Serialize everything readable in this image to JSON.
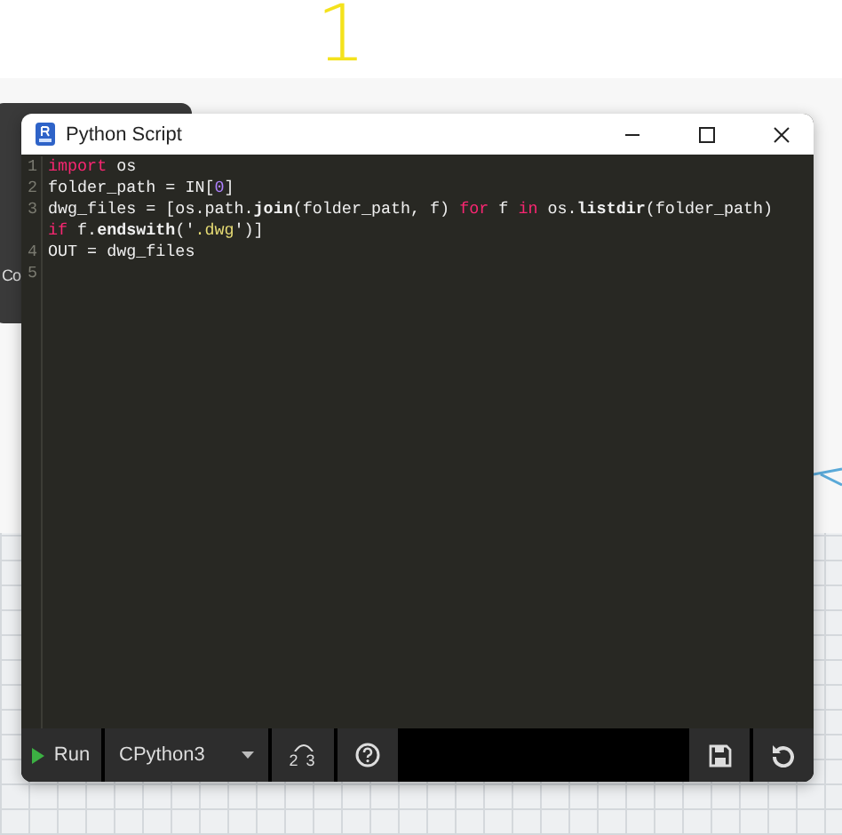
{
  "annotation": {
    "text": "1"
  },
  "background_node": {
    "text": "Co"
  },
  "window": {
    "title": "Python Script"
  },
  "editor": {
    "lines": [
      {
        "number": "1",
        "tokens": [
          {
            "text": "import",
            "kind": "keyword"
          },
          {
            "text": " os",
            "kind": "plain"
          }
        ]
      },
      {
        "number": "2",
        "tokens": [
          {
            "text": "folder_path = IN[",
            "kind": "plain"
          },
          {
            "text": "0",
            "kind": "number"
          },
          {
            "text": "]",
            "kind": "plain"
          }
        ]
      },
      {
        "number": "3",
        "tokens": [
          {
            "text": "dwg_files = [os.path.",
            "kind": "plain"
          },
          {
            "text": "join",
            "kind": "method"
          },
          {
            "text": "(folder_path, f) ",
            "kind": "plain"
          },
          {
            "text": "for",
            "kind": "keyword"
          },
          {
            "text": " f ",
            "kind": "plain"
          },
          {
            "text": "in",
            "kind": "keyword"
          },
          {
            "text": " os.",
            "kind": "plain"
          },
          {
            "text": "listdir",
            "kind": "method"
          },
          {
            "text": "(folder_path) ",
            "kind": "plain"
          },
          {
            "text": "if",
            "kind": "keyword"
          },
          {
            "text": " f.",
            "kind": "plain"
          },
          {
            "text": "endswith",
            "kind": "method"
          },
          {
            "text": "('",
            "kind": "plain"
          },
          {
            "text": ".dwg",
            "kind": "string"
          },
          {
            "text": "')]",
            "kind": "plain"
          }
        ]
      },
      {
        "number": "4",
        "tokens": [
          {
            "text": "OUT = dwg_files",
            "kind": "plain"
          }
        ]
      },
      {
        "number": "5"
      }
    ]
  },
  "toolbar": {
    "run_label": "Run",
    "engine": "CPython3",
    "migration_label": "2 3"
  }
}
